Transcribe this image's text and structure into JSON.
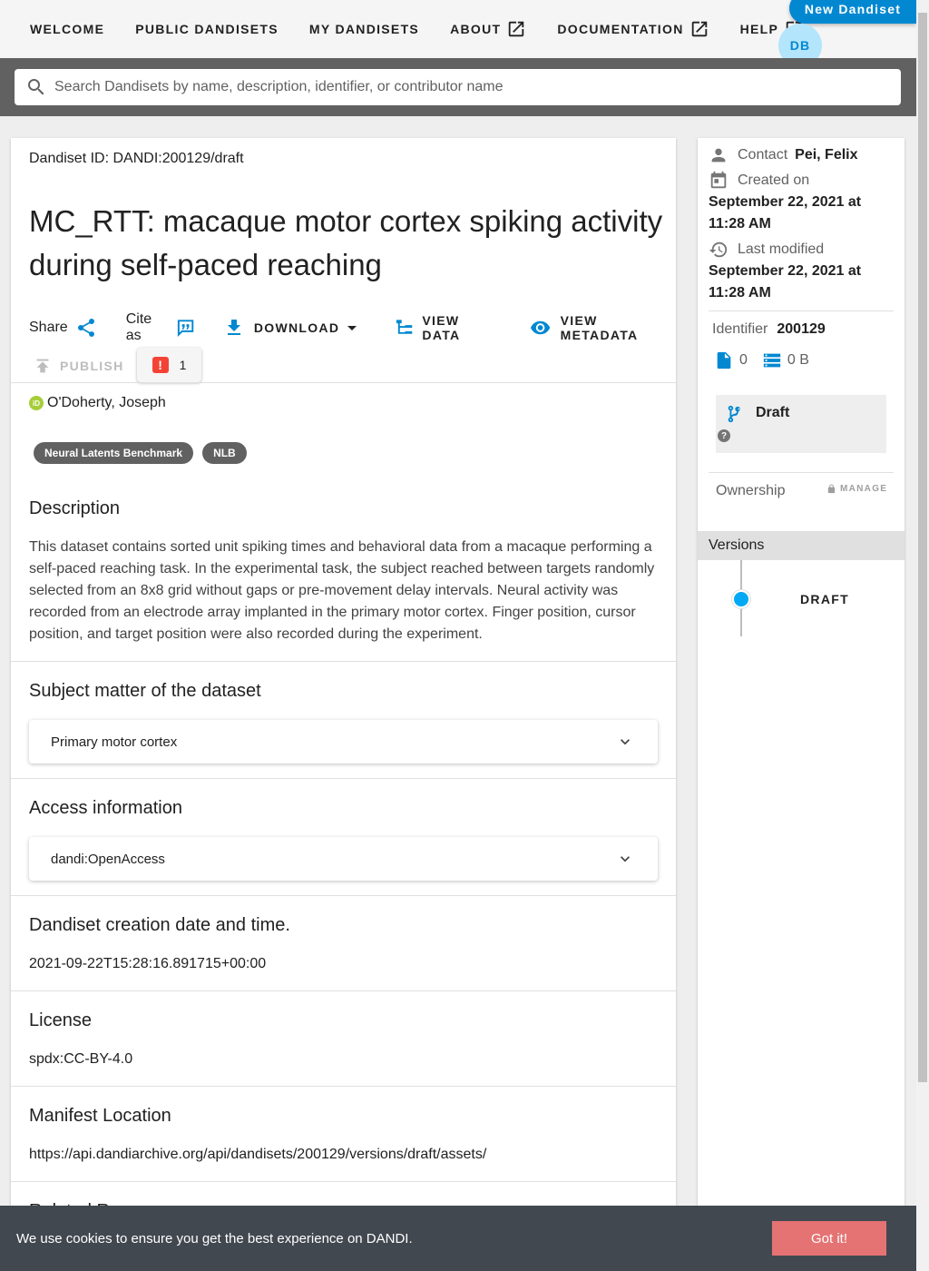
{
  "nav": {
    "items": [
      "Welcome",
      "Public Dandisets",
      "My Dandisets",
      "About",
      "Documentation",
      "Help"
    ],
    "new_dandiset": "New Dandiset",
    "avatar": "DB"
  },
  "search": {
    "placeholder": "Search Dandisets by name, description, identifier, or contributor name"
  },
  "dandiset": {
    "id_line": "Dandiset ID: DANDI:200129/draft",
    "title": "MC_RTT: macaque motor cortex spiking activity during self-paced reaching",
    "actions": {
      "share": "Share",
      "cite": "Cite as",
      "download": "Download",
      "view_data": "View Data",
      "view_metadata": "View Metadata",
      "publish": "Publish",
      "error_count": "1"
    },
    "contributor": "O'Doherty, Joseph",
    "keywords": [
      "Neural Latents Benchmark",
      "NLB"
    ],
    "description_heading": "Description",
    "description": "This dataset contains sorted unit spiking times and behavioral data from a macaque performing a self-paced reaching task. In the experimental task, the subject reached between targets randomly selected from an 8x8 grid without gaps or pre-movement delay intervals. Neural activity was recorded from an electrode array implanted in the primary motor cortex. Finger position, cursor position, and target position were also recorded during the experiment.",
    "subject_heading": "Subject matter of the dataset",
    "subject_value": "Primary motor cortex",
    "access_heading": "Access information",
    "access_value": "dandi:OpenAccess",
    "created_heading": "Dandiset creation date and time.",
    "created_value": "2021-09-22T15:28:16.891715+00:00",
    "license_heading": "License",
    "license_value": "spdx:CC-BY-4.0",
    "manifest_heading": "Manifest Location",
    "manifest_value": "https://api.dandiarchive.org/api/dandisets/200129/versions/draft/assets/",
    "related_heading": "Related Resources"
  },
  "side": {
    "contact_label": "Contact",
    "contact_name": "Pei, Felix",
    "created_label": "Created on",
    "created_date": "September 22, 2021 at 11:28 AM",
    "modified_label": "Last modified",
    "modified_date": "September 22, 2021 at 11:28 AM",
    "identifier_label": "Identifier",
    "identifier_value": "200129",
    "file_count": "0",
    "size": "0 B",
    "status": "Draft",
    "status_help": "?",
    "ownership_label": "Ownership",
    "manage": "Manage",
    "versions_label": "Versions",
    "version_item": "DRAFT"
  },
  "cookie": {
    "message": "We use cookies to ensure you get the best experience on DANDI.",
    "button": "Got it!"
  },
  "colors": {
    "primary": "#0288d1",
    "error": "#f44336",
    "cookie_button": "#e57373"
  }
}
